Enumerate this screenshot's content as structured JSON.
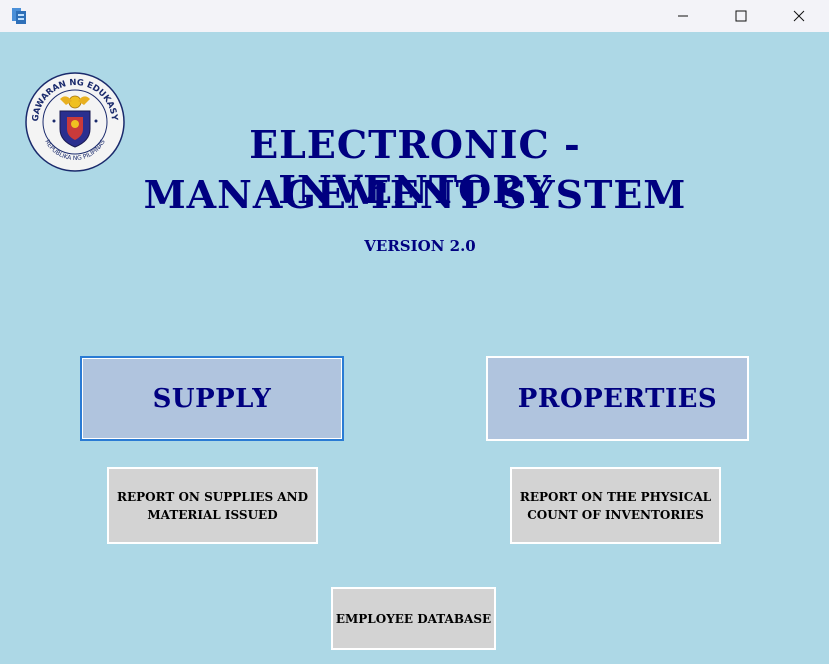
{
  "titlebar": {
    "minimize_glyph": "—",
    "maximize_glyph": "☐",
    "close_glyph": "✕"
  },
  "logo": {
    "top_text": "KAGAWARAN NG EDUKASYON",
    "bottom_text": "REPUBLIKA NG PILIPINAS"
  },
  "header": {
    "title_line1": "ELECTRONIC - INVENTORY",
    "title_line2": "MANAGEMENT SYSTEM",
    "version": "VERSION 2.0"
  },
  "buttons": {
    "supply": "SUPPLY",
    "properties": "PROPERTIES",
    "report_supplies_line1": "REPORT ON SUPPLIES AND",
    "report_supplies_line2": "MATERIAL ISSUED",
    "report_physical_line1": "REPORT ON THE PHYSICAL",
    "report_physical_line2": "COUNT OF INVENTORIES",
    "employee_database": "EMPLOYEE DATABASE"
  },
  "colors": {
    "background": "#add8e6",
    "title_text": "#000080",
    "big_button_bg": "#b0c4de",
    "small_button_bg": "#d3d3d3",
    "focus_border": "#2a7bd4"
  }
}
